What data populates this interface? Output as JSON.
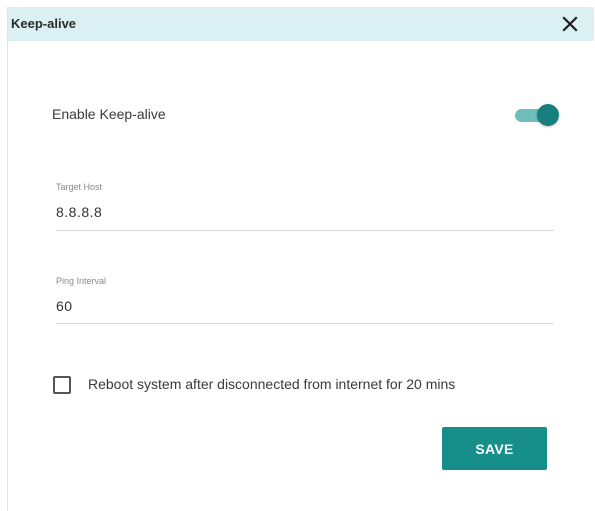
{
  "dialog": {
    "title": "Keep-alive",
    "close_icon": "close-icon"
  },
  "enable": {
    "label": "Enable Keep-alive",
    "enabled": true,
    "toggle_color": "#15807e"
  },
  "target_host": {
    "label": "Target Host",
    "value": "8.8.8.8"
  },
  "ping_interval": {
    "label": "Ping Interval",
    "value": "60"
  },
  "reboot": {
    "label": "Reboot system after disconnected from internet for 20 mins",
    "checked": false
  },
  "save_button": {
    "label": "SAVE",
    "color": "#168e89"
  },
  "colors": {
    "header_background": "#dbf0f2",
    "accent": "#168e89"
  }
}
